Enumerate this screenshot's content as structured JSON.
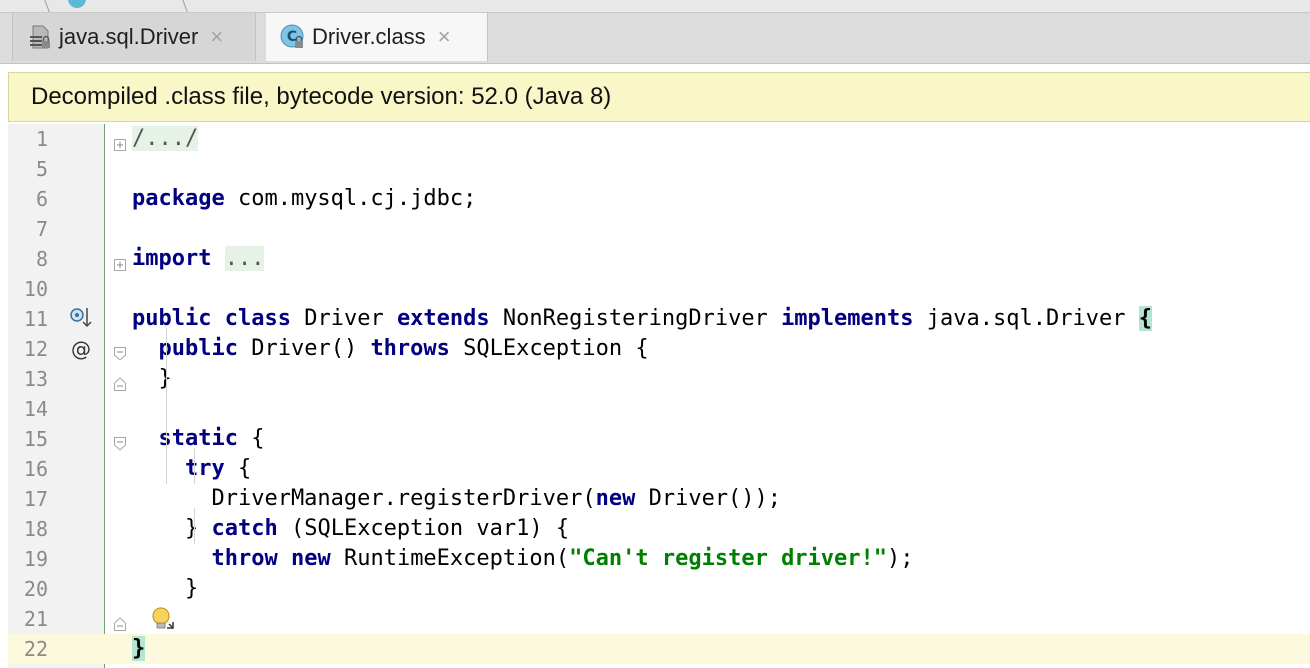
{
  "tabs": [
    {
      "label": "java.sql.Driver",
      "icon": "interface-file-icon",
      "active": false,
      "close": "×"
    },
    {
      "label": "Driver.class",
      "icon": "class-file-icon",
      "active": true,
      "close": "×"
    }
  ],
  "banner": {
    "text": "Decompiled .class file, bytecode version: 52.0 (Java 8)"
  },
  "editor": {
    "lines": [
      {
        "number": "1",
        "tokens": [
          {
            "t": "/.../",
            "c": "fold-region"
          }
        ]
      },
      {
        "number": "5",
        "tokens": []
      },
      {
        "number": "6",
        "tokens": [
          {
            "t": "package",
            "c": "kw"
          },
          {
            "t": " com.mysql.cj.jdbc;"
          }
        ]
      },
      {
        "number": "7",
        "tokens": []
      },
      {
        "number": "8",
        "tokens": [
          {
            "t": "import",
            "c": "kw"
          },
          {
            "t": " "
          },
          {
            "t": "...",
            "c": "fold-region"
          }
        ]
      },
      {
        "number": "10",
        "tokens": []
      },
      {
        "number": "11",
        "tokens": [
          {
            "t": "public",
            "c": "kw"
          },
          {
            "t": " "
          },
          {
            "t": "class",
            "c": "kw"
          },
          {
            "t": " Driver "
          },
          {
            "t": "extends",
            "c": "kw"
          },
          {
            "t": " NonRegisteringDriver "
          },
          {
            "t": "implements",
            "c": "kw"
          },
          {
            "t": " java.sql.Driver "
          },
          {
            "t": "{",
            "c": "brace-match"
          }
        ]
      },
      {
        "number": "12",
        "tokens": [
          {
            "t": "  "
          },
          {
            "t": "public",
            "c": "kw"
          },
          {
            "t": " Driver() "
          },
          {
            "t": "throws",
            "c": "kw"
          },
          {
            "t": " SQLException {"
          }
        ]
      },
      {
        "number": "13",
        "tokens": [
          {
            "t": "  }"
          }
        ]
      },
      {
        "number": "14",
        "tokens": []
      },
      {
        "number": "15",
        "tokens": [
          {
            "t": "  "
          },
          {
            "t": "static",
            "c": "kw"
          },
          {
            "t": " {"
          }
        ]
      },
      {
        "number": "16",
        "tokens": [
          {
            "t": "    "
          },
          {
            "t": "try",
            "c": "kw"
          },
          {
            "t": " {"
          }
        ]
      },
      {
        "number": "17",
        "tokens": [
          {
            "t": "      DriverManager.registerDriver("
          },
          {
            "t": "new",
            "c": "kw"
          },
          {
            "t": " Driver());"
          }
        ]
      },
      {
        "number": "18",
        "tokens": [
          {
            "t": "    } "
          },
          {
            "t": "catch",
            "c": "kw"
          },
          {
            "t": " (SQLException var1) {"
          }
        ]
      },
      {
        "number": "19",
        "tokens": [
          {
            "t": "      "
          },
          {
            "t": "throw",
            "c": "kw"
          },
          {
            "t": " "
          },
          {
            "t": "new",
            "c": "kw"
          },
          {
            "t": " RuntimeException("
          },
          {
            "t": "\"Can't register driver!\"",
            "c": "str"
          },
          {
            "t": ");"
          }
        ]
      },
      {
        "number": "20",
        "tokens": [
          {
            "t": "    }"
          }
        ]
      },
      {
        "number": "21",
        "tokens": []
      },
      {
        "number": "22",
        "tokens": [
          {
            "t": "}",
            "c": "brace-match"
          }
        ]
      }
    ],
    "gutter_marks": {
      "11": "implemented-by-icon",
      "12": "@"
    },
    "current_line": "22",
    "intention_bulb_line": "21"
  },
  "colors": {
    "keyword": "#000080",
    "string": "#008000",
    "banner_bg": "#f9f6c8",
    "current_line_bg": "#fcf9dc",
    "brace_match_bg": "#b4e4d2"
  }
}
